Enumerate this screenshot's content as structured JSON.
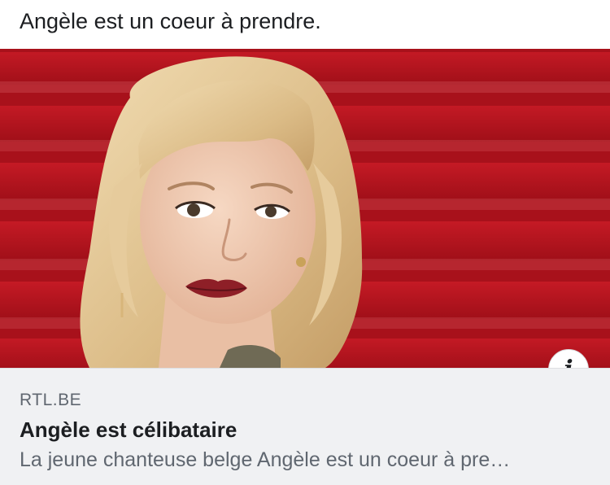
{
  "post": {
    "text": "Angèle est un coeur à prendre."
  },
  "link_preview": {
    "image_subject": "portrait photo of a blonde woman with bangs in front of a red background",
    "info_icon": "info-icon",
    "info_glyph": "i",
    "domain": "RTL.BE",
    "title": "Angèle est célibataire",
    "description": "La jeune chanteuse belge Angèle est un coeur à pre…"
  },
  "colors": {
    "background_red": "#b3121d",
    "caption_background": "#f0f1f3",
    "text_primary": "#1c1e21",
    "text_secondary": "#606770",
    "hair": "#e2c595",
    "skin": "#f2cdb4",
    "lips": "#8e1f27"
  }
}
